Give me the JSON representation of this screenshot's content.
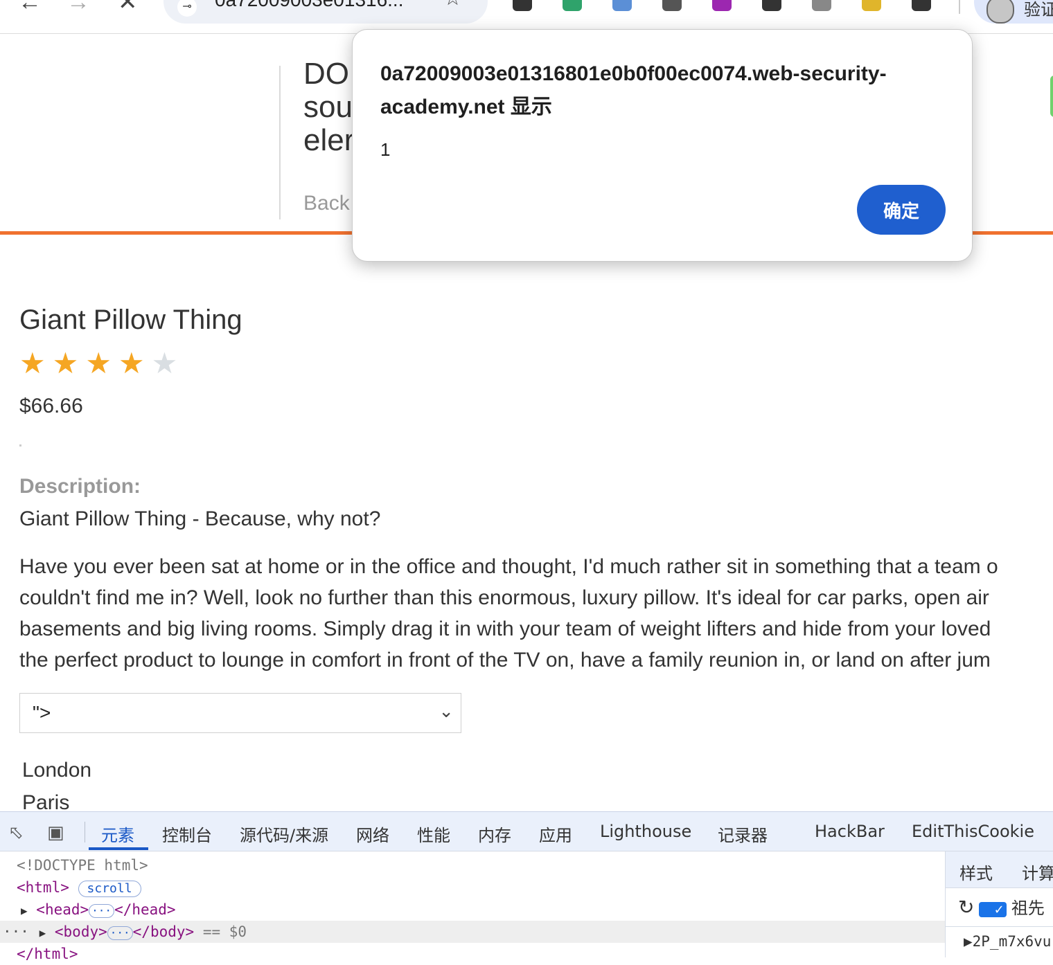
{
  "browser": {
    "url": "0a72009003e01316...",
    "profile_label": "验证",
    "back_icon": "←",
    "forward_icon": "→",
    "stop_icon": "✕",
    "star_icon": "☆",
    "site_info_icon": "⊸",
    "extensions": [
      {
        "name": "play-extension",
        "color": "#333333"
      },
      {
        "name": "code-extension",
        "color": "#2fa36b"
      },
      {
        "name": "graph-extension",
        "color": "#5b8fd6"
      },
      {
        "name": "refresh-extension",
        "color": "#555555"
      },
      {
        "name": "json-extension",
        "color": "#9c27b0"
      },
      {
        "name": "v-extension",
        "color": "#333333"
      },
      {
        "name": "doc-extension",
        "color": "#888888"
      },
      {
        "name": "translate-extension",
        "color": "#e0b52b"
      },
      {
        "name": "puzzle-extension",
        "color": "#333333"
      }
    ]
  },
  "lab": {
    "title_lines": [
      "DO",
      "sou",
      "eler"
    ],
    "back_link": "Back"
  },
  "alert": {
    "origin": "0a72009003e01316801e0b0f00ec0074.web-security-academy.net 显示",
    "message": "1",
    "ok_label": "确定"
  },
  "product": {
    "name": "Giant Pillow Thing",
    "rating": 4,
    "rating_max": 5,
    "price": "$66.66",
    "description_heading": "Description:",
    "description_subtitle": "Giant Pillow Thing - Because, why not?",
    "description_lines": [
      "Have you ever been sat at home or in the office and thought, I'd much rather sit in something that a team o",
      "couldn't find me in? Well, look no further than this enormous, luxury pillow. It's ideal for car parks, open air",
      "basements and big living rooms. Simply drag it in with your team of weight lifters and hide from your loved",
      "the perfect product to lounge in comfort in front of the TV on, have a family reunion in, or land on after jum"
    ],
    "store_select_value": "\">",
    "cities": [
      "London",
      "Paris"
    ]
  },
  "devtools": {
    "tabs": [
      "元素",
      "控制台",
      "源代码/来源",
      "网络",
      "性能",
      "内存",
      "应用",
      "Lighthouse",
      "记录器",
      "HackBar",
      "EditThisCookie"
    ],
    "active_tab": "元素",
    "code": {
      "doctype": "<!DOCTYPE html>",
      "html_open": "<html>",
      "scroll_badge": "scroll",
      "head_open": "<head>",
      "head_close": "</head>",
      "body_open": "<body>",
      "body_close": "</body>",
      "selected_suffix": "== $0",
      "html_close": "</html>",
      "ellipsis": "···"
    },
    "side_tabs": [
      "样式",
      "计算"
    ],
    "side_checkbox_label": "祖先",
    "side_row_text": "▶2P_m7x6vu"
  }
}
